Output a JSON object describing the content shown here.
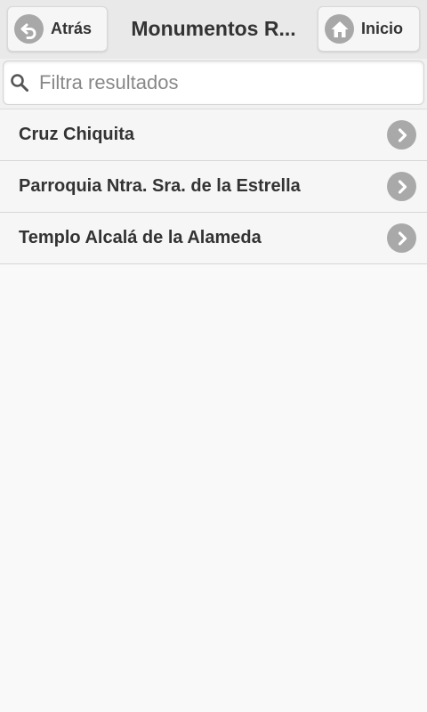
{
  "header": {
    "title": "Monumentos R...",
    "back_label": "Atrás",
    "home_label": "Inicio",
    "back_icon": "back-arrow-icon",
    "home_icon": "home-icon"
  },
  "search": {
    "placeholder": "Filtra resultados",
    "value": "",
    "icon": "search-icon"
  },
  "list": {
    "items": [
      {
        "label": "Cruz Chiquita",
        "icon": "chevron-right-icon"
      },
      {
        "label": "Parroquia Ntra. Sra. de la Estrella",
        "icon": "chevron-right-icon"
      },
      {
        "label": "Templo Alcalá de la Alameda",
        "icon": "chevron-right-icon"
      }
    ]
  },
  "colors": {
    "header_bg": "#e9e9e9",
    "page_bg": "#f9f9f9",
    "icon_circle": "#a8a8a8",
    "text": "#333333"
  }
}
